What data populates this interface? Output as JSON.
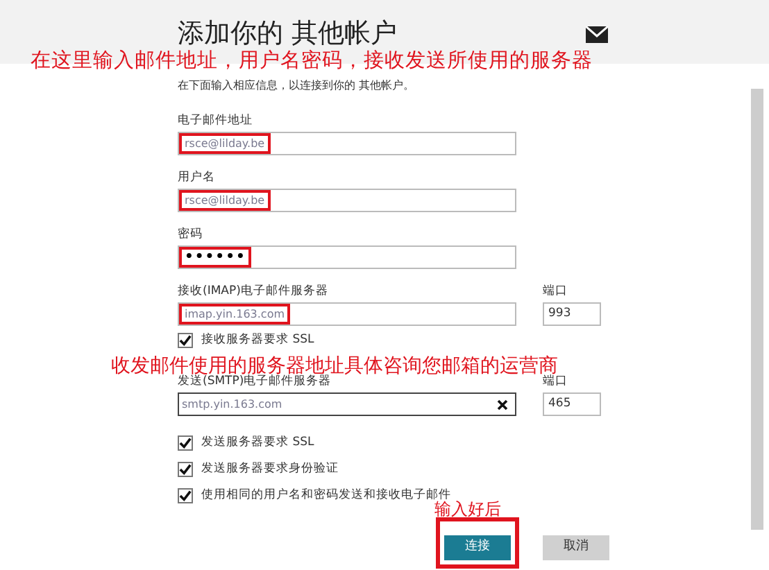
{
  "header": {
    "title": "添加你的 其他帐户"
  },
  "intro": "在下面输入相应信息，以连接到你的 其他帐户。",
  "fields": [
    {
      "label": "电子邮件地址",
      "value": "rsce@lilday.be",
      "highlighted": true
    },
    {
      "label": "用户名",
      "value": "rsce@lilday.be",
      "highlighted": true
    },
    {
      "label": "密码",
      "value": "••••••",
      "highlighted": true,
      "kind": "password"
    },
    {
      "label": "接收(IMAP)电子邮件服务器",
      "value": "imap.yin.163.com",
      "highlighted": true,
      "port_label": "端口",
      "port": "993"
    },
    {
      "label": "发送(SMTP)电子邮件服务器",
      "value": "smtp.yin.163.com",
      "highlighted": false,
      "clear_button": true,
      "port_label": "端口",
      "port": "465"
    }
  ],
  "checkboxes": [
    {
      "label": "接收服务器要求 SSL",
      "checked": true
    },
    {
      "label": "发送服务器要求 SSL",
      "checked": true
    },
    {
      "label": "发送服务器要求身份验证",
      "checked": true
    },
    {
      "label": "使用相同的用户名和密码发送和接收电子邮件",
      "checked": true
    }
  ],
  "buttons": [
    {
      "label": "连接",
      "primary": true,
      "highlighted": true
    },
    {
      "label": "取消",
      "primary": false,
      "highlighted": false
    }
  ],
  "annotations": [
    {
      "text": "在这里输入邮件地址，用户名密码，接收发送所使用的服务器"
    },
    {
      "text": "收发邮件使用的服务器地址具体咨询您邮箱的运营商"
    },
    {
      "text": "输入好后"
    }
  ]
}
